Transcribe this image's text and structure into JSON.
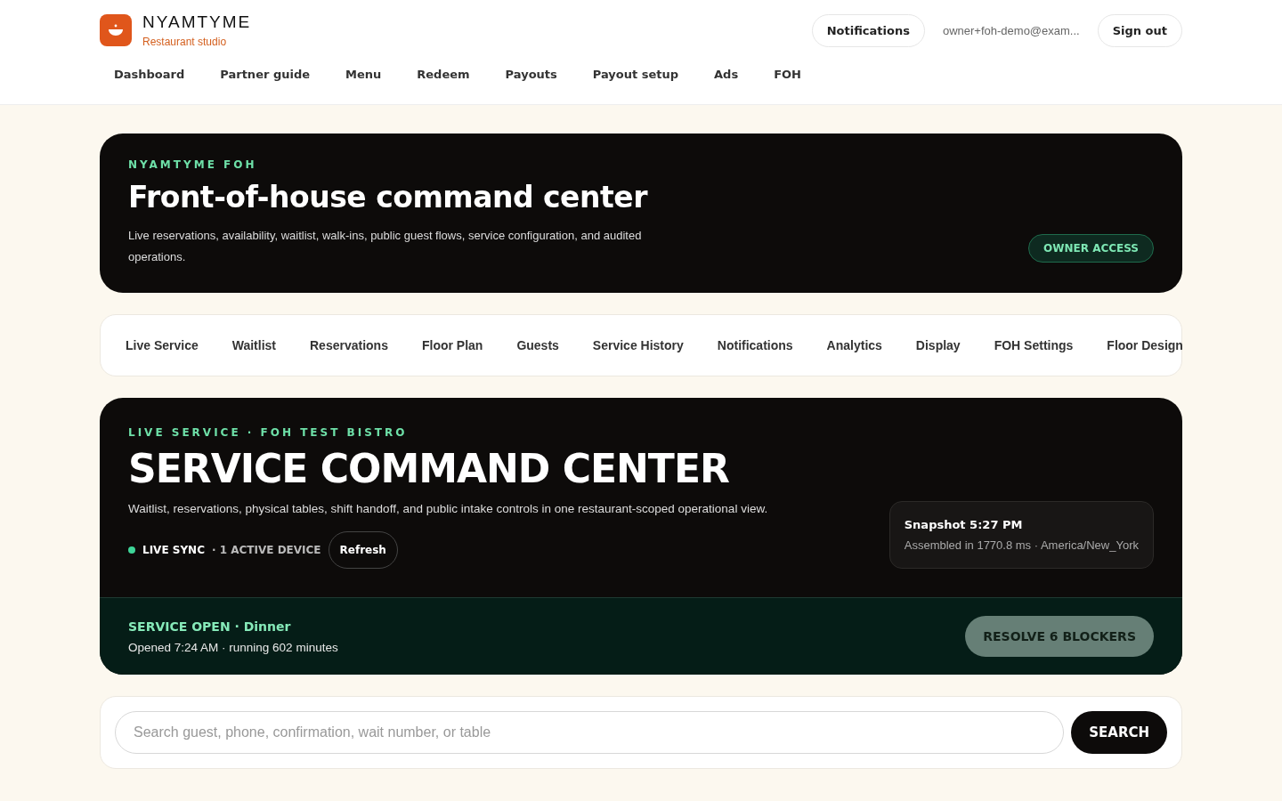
{
  "brand": {
    "name": "NYAMTYME",
    "subtitle": "Restaurant studio"
  },
  "header_actions": {
    "notifications": "Notifications",
    "email": "owner+foh-demo@exam...",
    "sign_out": "Sign out"
  },
  "nav": [
    "Dashboard",
    "Partner guide",
    "Menu",
    "Redeem",
    "Payouts",
    "Payout setup",
    "Ads",
    "FOH"
  ],
  "hero": {
    "eyebrow": "NYAMTYME FOH",
    "title": "Front-of-house command center",
    "description": "Live reservations, availability, waitlist, walk-ins, public guest flows, service configuration, and audited operations.",
    "badge": "OWNER ACCESS"
  },
  "foh_tabs": [
    "Live Service",
    "Waitlist",
    "Reservations",
    "Floor Plan",
    "Guests",
    "Service History",
    "Notifications",
    "Analytics",
    "Display",
    "FOH Settings",
    "Floor Design"
  ],
  "live": {
    "eyebrow": "LIVE SERVICE · FOH TEST BISTRO",
    "title": "SERVICE COMMAND CENTER",
    "description": "Waitlist, reservations, physical tables, shift handoff, and public intake controls in one restaurant-scoped operational view.",
    "sync_on": true,
    "sync_label": "LIVE SYNC",
    "devices": "· 1 ACTIVE DEVICE",
    "refresh": "Refresh",
    "snapshot_title": "Snapshot 5:27 PM",
    "snapshot_detail": "Assembled in 1770.8 ms · America/New_York"
  },
  "service": {
    "status": "SERVICE OPEN · Dinner",
    "detail": "Opened 7:24 AM · running 602 minutes",
    "action": "RESOLVE 6 BLOCKERS"
  },
  "search": {
    "placeholder": "Search guest, phone, confirmation, wait number, or table",
    "button": "SEARCH"
  }
}
